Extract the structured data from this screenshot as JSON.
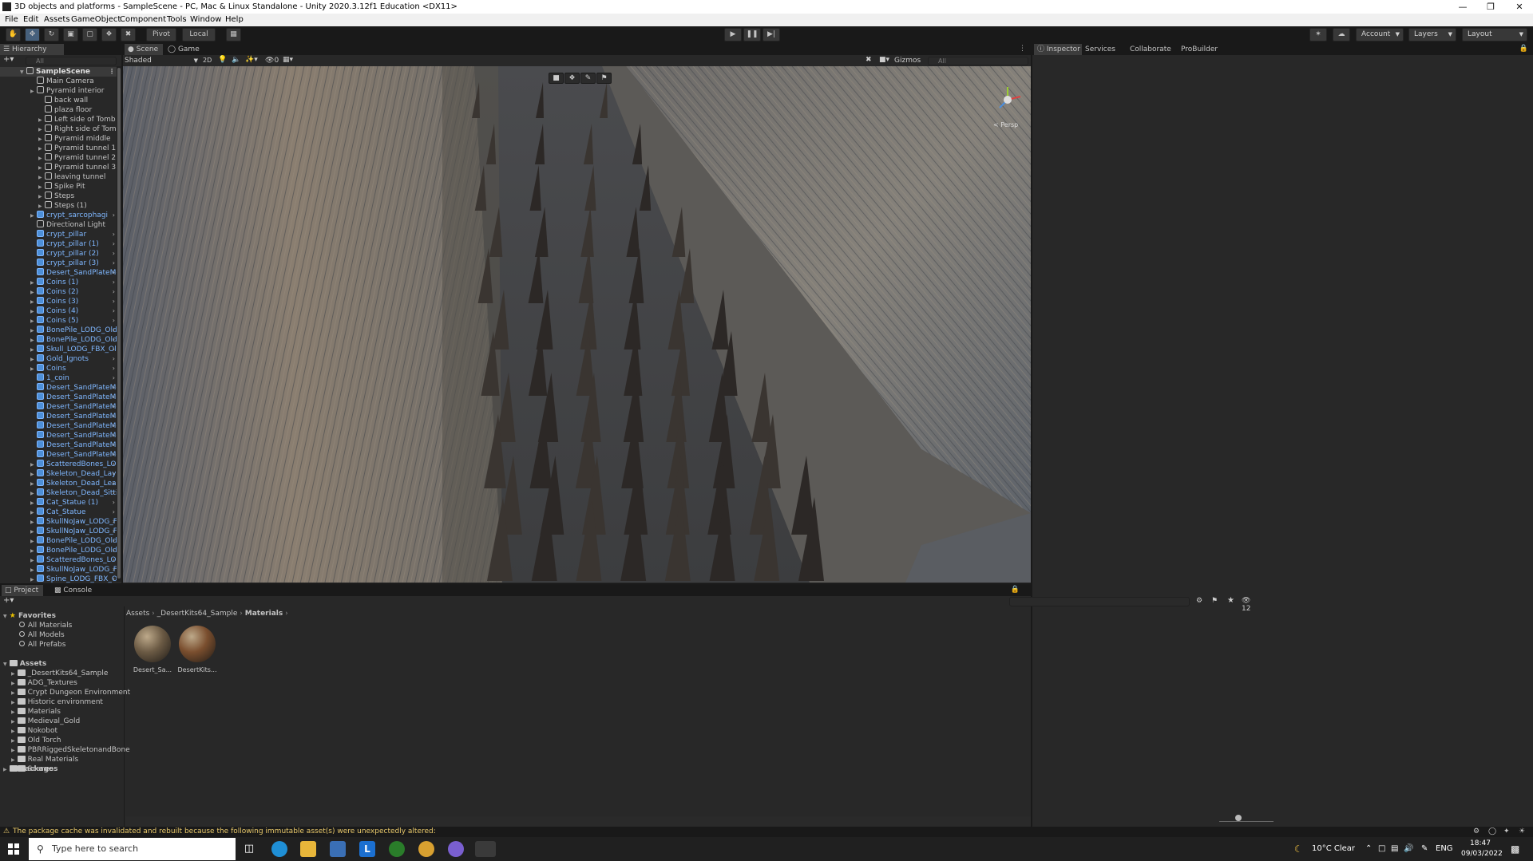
{
  "window": {
    "title": "3D objects and platforms - SampleScene - PC, Mac & Linux Standalone - Unity 2020.3.12f1 Education <DX11>"
  },
  "menu": [
    "File",
    "Edit",
    "Assets",
    "GameObject",
    "Component",
    "Tools",
    "Window",
    "Help"
  ],
  "toolbar": {
    "pivot": "Pivot",
    "local": "Local",
    "account": "Account",
    "layers": "Layers",
    "layout": "Layout"
  },
  "hierarchy": {
    "tab": "Hierarchy",
    "search_placeholder": "All",
    "scene": "SampleScene",
    "items": [
      {
        "label": "Main Camera",
        "indent": 1,
        "prefab": false,
        "arrow": false
      },
      {
        "label": "Pyramid interior",
        "indent": 1,
        "prefab": false,
        "arrow": true
      },
      {
        "label": "back wall",
        "indent": 2,
        "prefab": false,
        "arrow": false
      },
      {
        "label": "plaza floor",
        "indent": 2,
        "prefab": false,
        "arrow": false
      },
      {
        "label": "Left side of Tomb",
        "indent": 2,
        "prefab": false,
        "arrow": true
      },
      {
        "label": "Right side of Tomb",
        "indent": 2,
        "prefab": false,
        "arrow": true
      },
      {
        "label": "Pyramid middle",
        "indent": 2,
        "prefab": false,
        "arrow": true
      },
      {
        "label": "Pyramid tunnel 1",
        "indent": 2,
        "prefab": false,
        "arrow": true
      },
      {
        "label": "Pyramid tunnel 2",
        "indent": 2,
        "prefab": false,
        "arrow": true
      },
      {
        "label": "Pyramid tunnel 3",
        "indent": 2,
        "prefab": false,
        "arrow": true
      },
      {
        "label": "leaving tunnel",
        "indent": 2,
        "prefab": false,
        "arrow": true
      },
      {
        "label": "Spike Pit",
        "indent": 2,
        "prefab": false,
        "arrow": true
      },
      {
        "label": "Steps",
        "indent": 2,
        "prefab": false,
        "arrow": true
      },
      {
        "label": "Steps (1)",
        "indent": 2,
        "prefab": false,
        "arrow": true
      },
      {
        "label": "crypt_sarcophagi",
        "indent": 1,
        "prefab": true,
        "arrow": true
      },
      {
        "label": "Directional Light",
        "indent": 1,
        "prefab": false,
        "arrow": false
      },
      {
        "label": "crypt_pillar",
        "indent": 1,
        "prefab": true,
        "arrow": false
      },
      {
        "label": "crypt_pillar (1)",
        "indent": 1,
        "prefab": true,
        "arrow": false
      },
      {
        "label": "crypt_pillar (2)",
        "indent": 1,
        "prefab": true,
        "arrow": false
      },
      {
        "label": "crypt_pillar (3)",
        "indent": 1,
        "prefab": true,
        "arrow": false
      },
      {
        "label": "Desert_SandPlateMedium",
        "indent": 1,
        "prefab": true,
        "arrow": false
      },
      {
        "label": "Coins (1)",
        "indent": 1,
        "prefab": true,
        "arrow": true
      },
      {
        "label": "Coins (2)",
        "indent": 1,
        "prefab": true,
        "arrow": true
      },
      {
        "label": "Coins (3)",
        "indent": 1,
        "prefab": true,
        "arrow": true
      },
      {
        "label": "Coins (4)",
        "indent": 1,
        "prefab": true,
        "arrow": true
      },
      {
        "label": "Coins (5)",
        "indent": 1,
        "prefab": true,
        "arrow": true
      },
      {
        "label": "BonePile_LODG_OldBone",
        "indent": 1,
        "prefab": true,
        "arrow": true
      },
      {
        "label": "BonePile_LODG_OldBone",
        "indent": 1,
        "prefab": true,
        "arrow": true
      },
      {
        "label": "Skull_LODG_FBX_OldBon",
        "indent": 1,
        "prefab": true,
        "arrow": true
      },
      {
        "label": "Gold_Ignots",
        "indent": 1,
        "prefab": true,
        "arrow": true
      },
      {
        "label": "Coins",
        "indent": 1,
        "prefab": true,
        "arrow": true
      },
      {
        "label": "1_coin",
        "indent": 1,
        "prefab": true,
        "arrow": false
      },
      {
        "label": "Desert_SandPlateMedium",
        "indent": 1,
        "prefab": true,
        "arrow": false
      },
      {
        "label": "Desert_SandPlateMedium",
        "indent": 1,
        "prefab": true,
        "arrow": false
      },
      {
        "label": "Desert_SandPlateMedium",
        "indent": 1,
        "prefab": true,
        "arrow": false
      },
      {
        "label": "Desert_SandPlateMedium",
        "indent": 1,
        "prefab": true,
        "arrow": false
      },
      {
        "label": "Desert_SandPlateMedium",
        "indent": 1,
        "prefab": true,
        "arrow": false
      },
      {
        "label": "Desert_SandPlateMedium",
        "indent": 1,
        "prefab": true,
        "arrow": false
      },
      {
        "label": "Desert_SandPlateMedium",
        "indent": 1,
        "prefab": true,
        "arrow": false
      },
      {
        "label": "Desert_SandPlateMedium",
        "indent": 1,
        "prefab": true,
        "arrow": false
      },
      {
        "label": "ScatteredBones_LODG_C",
        "indent": 1,
        "prefab": true,
        "arrow": true
      },
      {
        "label": "Skeleton_Dead_Laying_L",
        "indent": 1,
        "prefab": true,
        "arrow": true
      },
      {
        "label": "Skeleton_Dead_Leaning_",
        "indent": 1,
        "prefab": true,
        "arrow": true
      },
      {
        "label": "Skeleton_Dead_Sitting_L(",
        "indent": 1,
        "prefab": true,
        "arrow": true
      },
      {
        "label": "Cat_Statue (1)",
        "indent": 1,
        "prefab": true,
        "arrow": true
      },
      {
        "label": "Cat_Statue",
        "indent": 1,
        "prefab": true,
        "arrow": true
      },
      {
        "label": "SkullNoJaw_LODG_FBX_",
        "indent": 1,
        "prefab": true,
        "arrow": true
      },
      {
        "label": "SkullNoJaw_LODG_FBX_",
        "indent": 1,
        "prefab": true,
        "arrow": true
      },
      {
        "label": "BonePile_LODG_OldBone",
        "indent": 1,
        "prefab": true,
        "arrow": true
      },
      {
        "label": "BonePile_LODG_OldBone",
        "indent": 1,
        "prefab": true,
        "arrow": true
      },
      {
        "label": "ScatteredBones_LODG_C",
        "indent": 1,
        "prefab": true,
        "arrow": true
      },
      {
        "label": "SkullNoJaw_LODG_FBX_",
        "indent": 1,
        "prefab": true,
        "arrow": true
      },
      {
        "label": "Spine_LODG_FBX_OldBor",
        "indent": 1,
        "prefab": true,
        "arrow": true
      }
    ]
  },
  "scene": {
    "tabs": [
      "Scene",
      "Game"
    ],
    "shading": "Shaded",
    "mode_2d": "2D",
    "hidden_count": "0",
    "gizmos": "Gizmos",
    "search_placeholder": "All",
    "persp": "< Persp"
  },
  "inspector": {
    "tabs": [
      "Inspector",
      "Services",
      "Collaborate",
      "ProBuilder"
    ]
  },
  "project": {
    "tabs": [
      "Project",
      "Console"
    ],
    "favorites_label": "Favorites",
    "favorites": [
      "All Materials",
      "All Models",
      "All Prefabs"
    ],
    "assets_label": "Assets",
    "folders": [
      "_DesertKits64_Sample",
      "ADG_Textures",
      "Crypt Dungeon Environment",
      "Historic environment",
      "Materials",
      "Medieval_Gold",
      "Nokobot",
      "Old Torch",
      "PBRRiggedSkeletonandBone",
      "Real Materials",
      "Scenes"
    ],
    "packages_label": "Packages",
    "breadcrumb": [
      "Assets",
      "_DesertKits64_Sample",
      "Materials"
    ],
    "hidden_count": "12",
    "assets": [
      {
        "name": "Desert_Sa...",
        "color": "#6b5a44"
      },
      {
        "name": "DesertKits...",
        "color": "#7a4e2e"
      }
    ]
  },
  "status": {
    "message": "The package cache was invalidated and rebuilt because the following immutable asset(s) were unexpectedly altered:"
  },
  "taskbar": {
    "search_placeholder": "Type here to search",
    "weather": "10°C  Clear",
    "language": "ENG",
    "time": "18:47",
    "date": "09/03/2022"
  },
  "colors": {
    "accent": "#46607c",
    "prefab_text": "#7fb7ff",
    "warning": "#e8c86a"
  }
}
